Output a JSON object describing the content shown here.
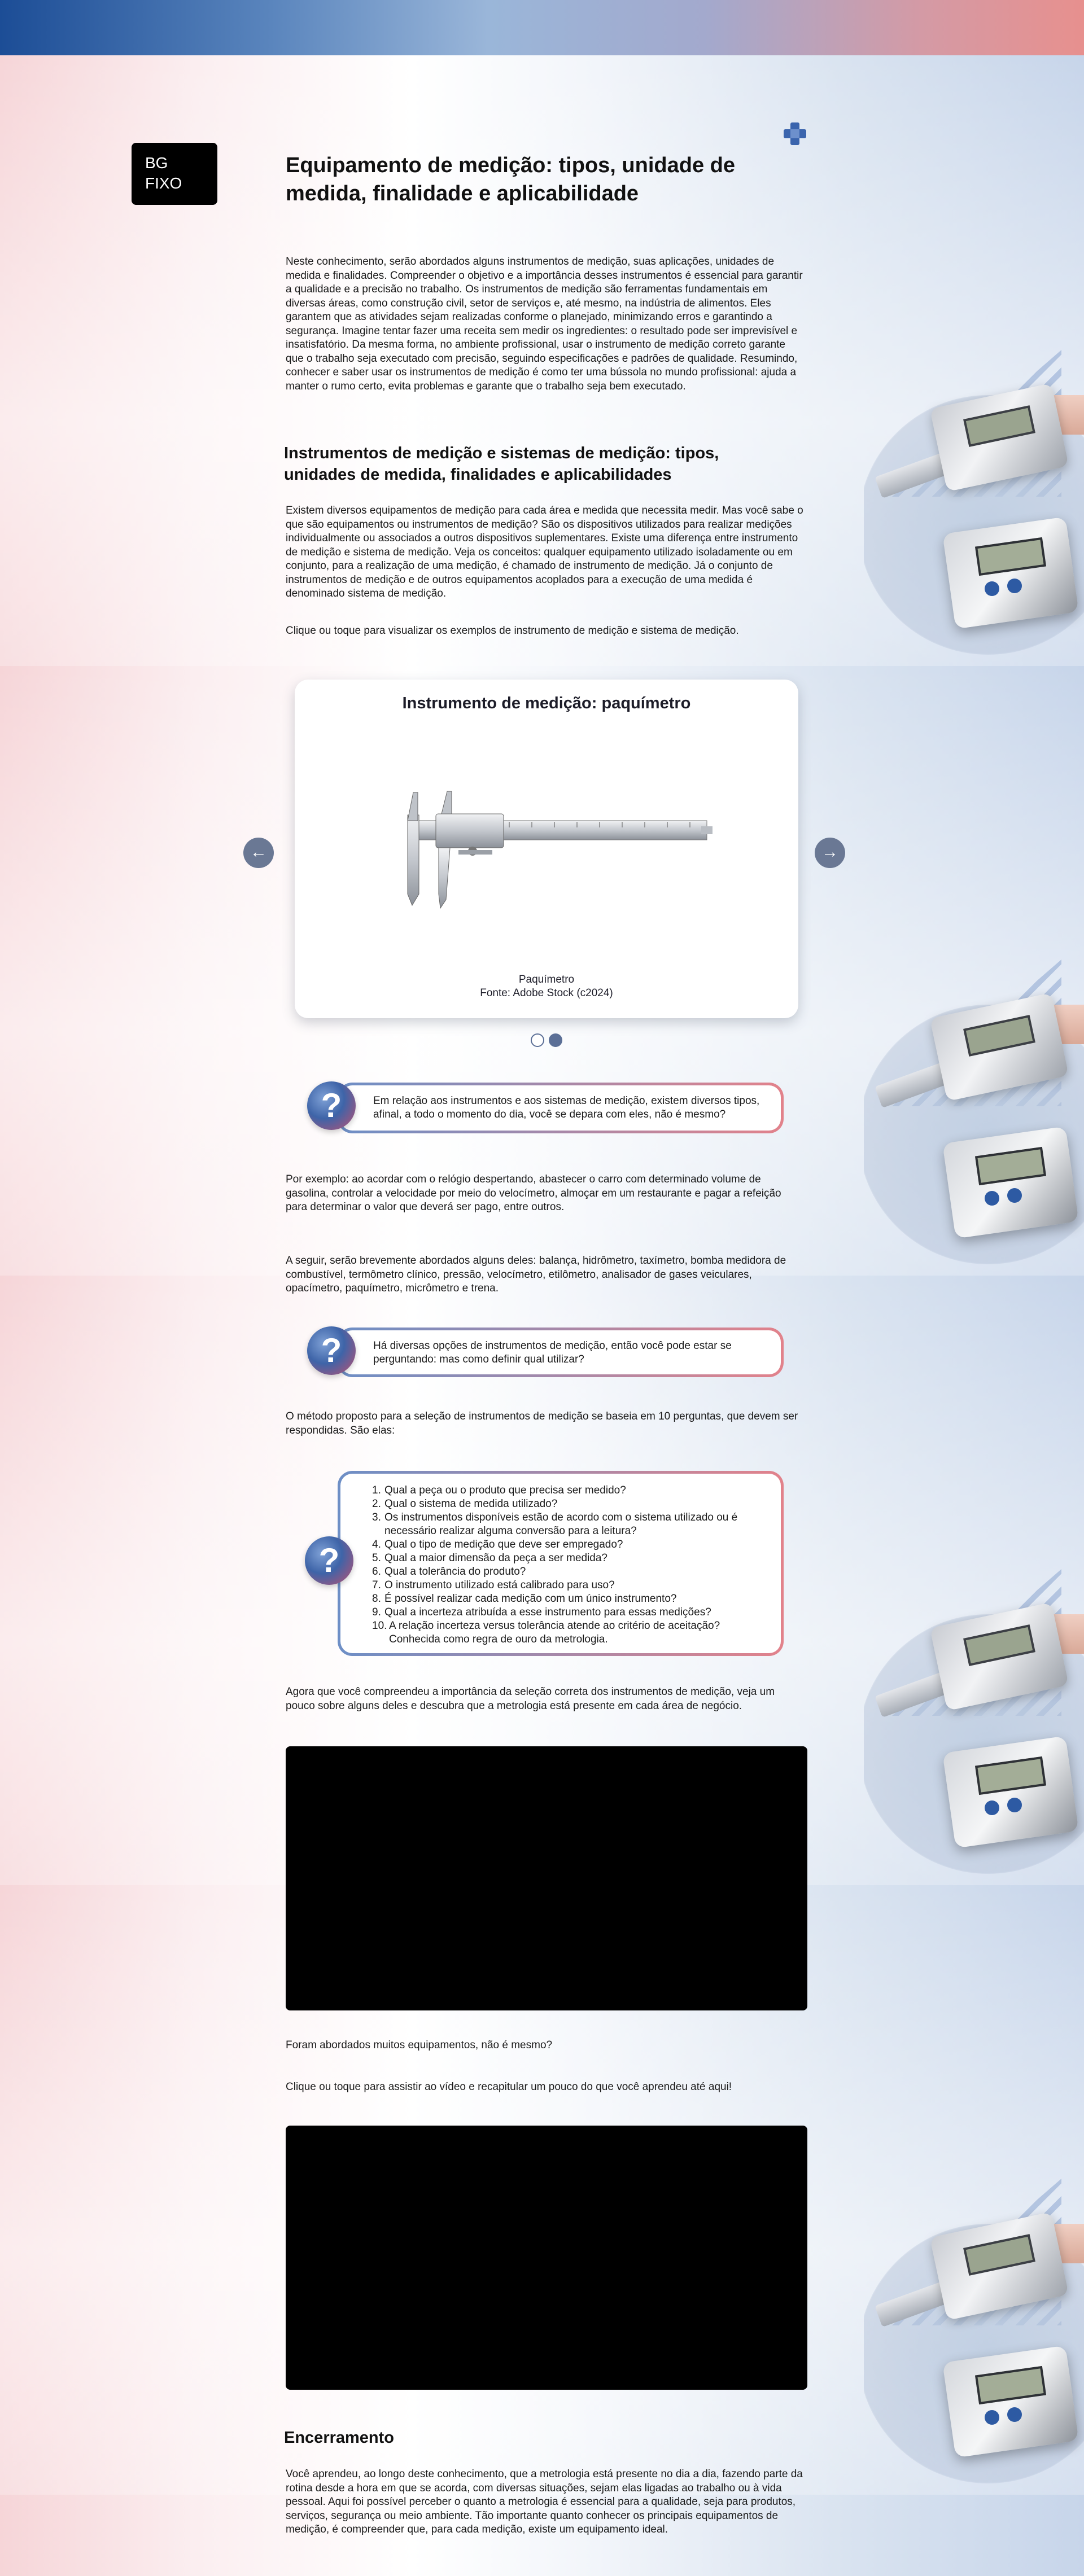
{
  "header": {
    "badge": "BG\nFIXO",
    "title": "Equipamento de medição: tipos, unidade de medida, finalidade e aplicabilidade",
    "logo_icon": "cross-medical-icon"
  },
  "intro": {
    "text": "Neste conhecimento, serão abordados alguns instrumentos de medição, suas aplicações, unidades de medida e finalidades. Compreender o objetivo e a importância desses instrumentos é essencial para garantir a qualidade e a precisão no trabalho. Os instrumentos de medição são ferramentas fundamentais em diversas áreas, como construção civil, setor de serviços e, até mesmo, na indústria de alimentos. Eles garantem que as atividades sejam realizadas conforme o planejado, minimizando erros e garantindo a segurança. Imagine tentar fazer uma receita sem medir os ingredientes: o resultado pode ser imprevisível e insatisfatório. Da mesma forma, no ambiente profissional, usar o instrumento de medição correto garante que o trabalho seja executado com precisão, seguindo especificações e padrões de qualidade. Resumindo, conhecer e saber usar os instrumentos de medição é como ter uma bússola no mundo profissional: ajuda a manter o rumo certo, evita problemas e garante que o trabalho seja bem executado."
  },
  "section1": {
    "heading": "Instrumentos de medição e sistemas de medição: tipos, unidades de medida, finalidades e aplicabilidades",
    "text": "Existem diversos equipamentos de medição para cada área e medida que necessita medir. Mas você sabe o que são equipamentos ou instrumentos de medição? São os dispositivos utilizados para realizar medições individualmente ou associados a outros dispositivos suplementares. Existe uma diferença entre instrumento de medição e sistema de medição. Veja os conceitos: qualquer equipamento utilizado isoladamente ou em conjunto, para a realização de uma medição, é chamado de instrumento de medição. Já o conjunto de instrumentos de medição e de outros equipamentos acoplados para a execução de uma medida é denominado sistema de medição.",
    "hint": "Clique ou toque para visualizar os exemplos de instrumento de medição e sistema de medição."
  },
  "carousel": {
    "title": "Instrumento de medição: paquímetro",
    "caption_line1": "Paquímetro",
    "caption_line2": "Fonte: Adobe Stock (c2024)",
    "prev_icon": "arrow-left-icon",
    "next_icon": "arrow-right-icon",
    "prev_glyph": "←",
    "next_glyph": "→"
  },
  "callout1": {
    "text": "Em relação aos instrumentos e aos sistemas de medição, existem diversos tipos, afinal, a todo o momento do dia, você se depara com eles, não é mesmo?"
  },
  "para_example": "Por exemplo: ao acordar com o relógio despertando, abastecer o carro com determinado volume de gasolina, controlar a velocidade por meio do velocímetro, almoçar em um restaurante e pagar a refeição para determinar o valor que deverá ser pago, entre outros.",
  "para_list": "A seguir, serão brevemente abordados alguns deles: balança, hidrômetro, taxímetro, bomba medidora de combustível, termômetro clínico, pressão, velocímetro, etilômetro, analisador de gases veiculares, opacímetro, paquímetro, micrômetro e trena.",
  "callout2": {
    "text": "Há diversas opções de instrumentos de medição, então você pode estar se perguntando: mas como definir qual utilizar?"
  },
  "para_method": "O método proposto para a seleção de instrumentos de medição se baseia em 10 perguntas, que devem ser respondidas. São elas:",
  "questions": [
    {
      "n": "1.",
      "text": "Qual a peça ou o produto que precisa ser medido?"
    },
    {
      "n": "2.",
      "text": "Qual o sistema de medida utilizado?"
    },
    {
      "n": "3.",
      "text": "Os instrumentos disponíveis estão de acordo com o sistema utilizado ou é necessário realizar alguma conversão para a leitura?"
    },
    {
      "n": "4.",
      "text": "Qual o tipo de medição que deve ser empregado?"
    },
    {
      "n": "5.",
      "text": "Qual a maior dimensão da peça a ser medida?"
    },
    {
      "n": "6.",
      "text": "Qual a tolerância do produto?"
    },
    {
      "n": "7.",
      "text": "O instrumento utilizado está calibrado para uso?"
    },
    {
      "n": "8.",
      "text": "É possível realizar cada medição com um único instrumento?"
    },
    {
      "n": "9.",
      "text": "Qual a incerteza atribuída a esse instrumento para essas medições?"
    },
    {
      "n": "10.",
      "text": "A relação incerteza versus tolerância atende ao critério de aceitação? Conhecida como regra de ouro da metrologia."
    }
  ],
  "para_video_intro": "Agora que você compreendeu a importância da seleção correta dos instrumentos de medição, veja um pouco sobre alguns deles e descubra que a metrologia está presente em cada área de negócio.",
  "para_after_video1": "Foram abordados muitos equipamentos, não é mesmo?",
  "para_recap": "Clique ou toque para assistir ao vídeo e recapitular um pouco do que você aprendeu até aqui!",
  "closing": {
    "heading": "Encerramento",
    "text": "Você aprendeu, ao longo deste conhecimento, que a metrologia está presente no dia a dia, fazendo parte da rotina desde a hora em que se acorda, com diversas situações, sejam elas ligadas ao trabalho ou à vida pessoal. Aqui foi possível perceber o quanto a metrologia é essencial para a qualidade, seja para produtos, serviços, segurança ou meio ambiente. Tão importante quanto conhecer os principais equipamentos de medição, é compreender que, para cada medição, existe um equipamento ideal."
  },
  "colors": {
    "accent_blue": "#3e64a8",
    "accent_pink": "#e2828b",
    "nav_button": "#6a7894"
  }
}
